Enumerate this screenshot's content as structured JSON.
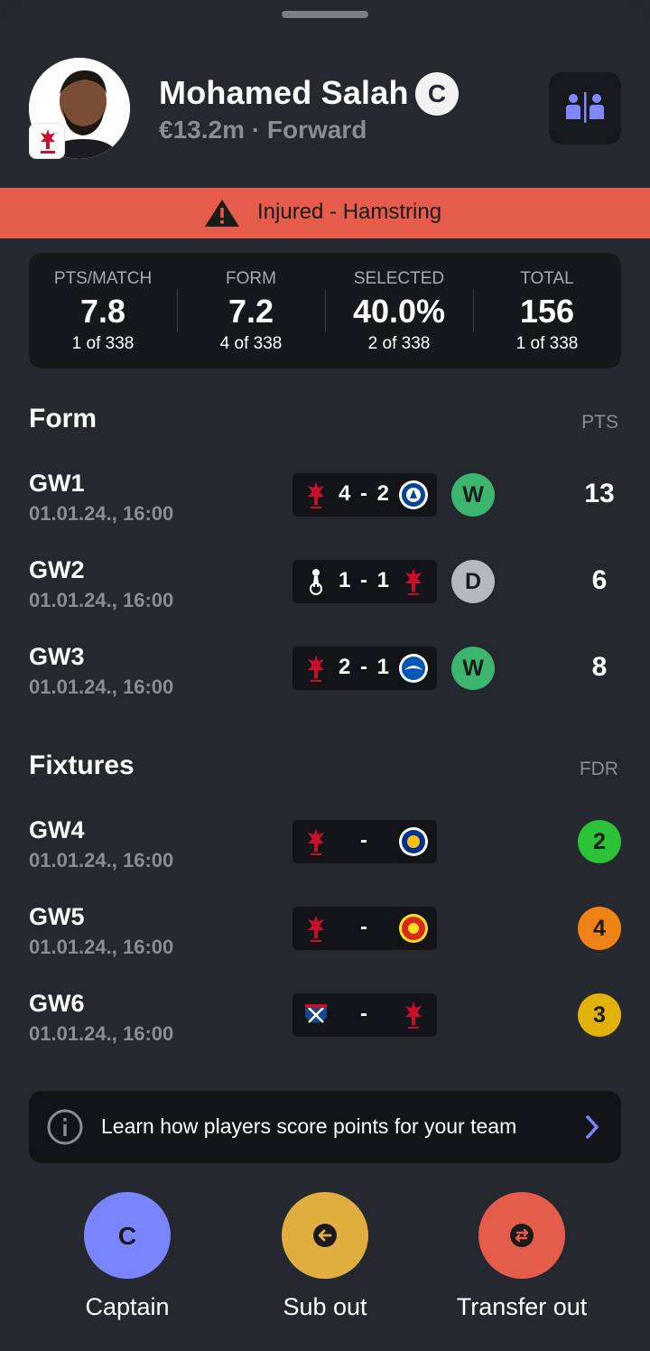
{
  "player": {
    "name": "Mohamed Salah",
    "captain_badge": "C",
    "meta": "€13.2m · Forward",
    "club_icon": "liverpool-crest-icon"
  },
  "injury": {
    "text": "Injured - Hamstring",
    "icon": "warning-icon",
    "color": "#e55c4a"
  },
  "stats": [
    {
      "label": "PTS/MATCH",
      "value": "7.8",
      "rank": "1 of 338"
    },
    {
      "label": "FORM",
      "value": "7.2",
      "rank": "4 of 338"
    },
    {
      "label": "SELECTED",
      "value": "40.0%",
      "rank": "2 of 338"
    },
    {
      "label": "TOTAL",
      "value": "156",
      "rank": "1 of 338"
    }
  ],
  "form": {
    "title": "Form",
    "column": "PTS",
    "rows": [
      {
        "gw": "GW1",
        "date": "01.01.24., 16:00",
        "home": "liverpool",
        "away": "chelsea",
        "score": "4-2",
        "result": "W",
        "points": "13"
      },
      {
        "gw": "GW2",
        "date": "01.01.24., 16:00",
        "home": "tottenham",
        "away": "liverpool",
        "score": "1-1",
        "result": "D",
        "points": "6"
      },
      {
        "gw": "GW3",
        "date": "01.01.24., 16:00",
        "home": "liverpool",
        "away": "brighton",
        "score": "2-1",
        "result": "W",
        "points": "8"
      }
    ]
  },
  "fixtures": {
    "title": "Fixtures",
    "column": "FDR",
    "rows": [
      {
        "gw": "GW4",
        "date": "01.01.24., 16:00",
        "home": "liverpool",
        "away": "leicester",
        "score": "-",
        "fdr": "2",
        "fdr_color": "#2bc236"
      },
      {
        "gw": "GW5",
        "date": "01.01.24., 16:00",
        "home": "liverpool",
        "away": "man-utd",
        "score": "-",
        "fdr": "4",
        "fdr_color": "#ef8214"
      },
      {
        "gw": "GW6",
        "date": "01.01.24., 16:00",
        "home": "crystal-palace",
        "away": "liverpool",
        "score": "-",
        "fdr": "3",
        "fdr_color": "#e0b20a"
      }
    ]
  },
  "info": {
    "text": "Learn how players score points for your team"
  },
  "actions": [
    {
      "label": "Captain",
      "icon": "C",
      "color": "#7b85fb"
    },
    {
      "label": "Sub out",
      "icon": "arrow-left-icon",
      "color": "#e0ad3f"
    },
    {
      "label": "Transfer out",
      "icon": "swap-icon",
      "color": "#e55c4a"
    }
  ]
}
